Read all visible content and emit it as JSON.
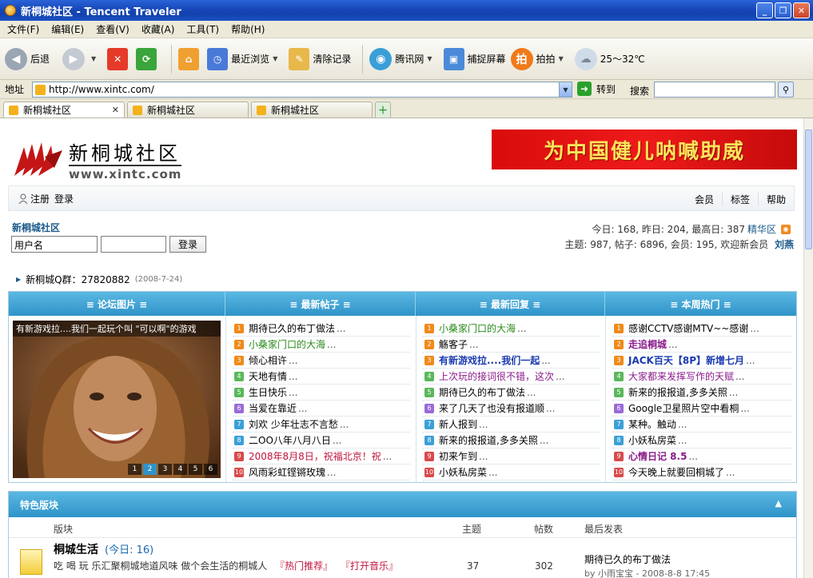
{
  "window": {
    "title": "新桐城社区 - Tencent Traveler"
  },
  "menu": [
    "文件(F)",
    "编辑(E)",
    "查看(V)",
    "收藏(A)",
    "工具(T)",
    "帮助(H)"
  ],
  "toolbar": {
    "back": "后退",
    "recent": "最近浏览",
    "clear": "清除记录",
    "tencent": "腾讯网",
    "capture": "捕捉屏幕",
    "paipai": "拍拍",
    "paipai_icon": "拍",
    "weather": "25～32℃"
  },
  "address": {
    "label": "地址",
    "url": "http://www.xintc.com/",
    "go": "转到",
    "search_label": "搜索"
  },
  "tabs": [
    "新桐城社区",
    "新桐城社区",
    "新桐城社区"
  ],
  "site": {
    "logo_name": "新桐城社区",
    "logo_url": "www.xintc.com",
    "banner": "为中国健儿呐喊助威"
  },
  "userbar": {
    "register": "注册",
    "login": "登录",
    "right": [
      "会员",
      "标签",
      "帮助"
    ]
  },
  "login": {
    "forum_name": "新桐城社区",
    "username_value": "用户名",
    "button": "登录"
  },
  "stats": {
    "line1": "今日: 168, 昨日: 204, 最高日: 387",
    "digest": "精华区",
    "line2": "主题: 987, 帖子: 6896, 会员: 195, 欢迎新会员",
    "new_member": "刘燕"
  },
  "qq": {
    "text": "新桐城Q群：27820882",
    "date": "(2008-7-24)"
  },
  "columns": [
    "≡ 论坛图片 ≡",
    "≡ 最新帖子 ≡",
    "≡ 最新回复 ≡",
    "≡ 本周热门 ≡"
  ],
  "picture": {
    "caption": "有新游戏拉....我们一起玩个叫 \"可以啊\"的游戏",
    "pages": [
      "1",
      "2",
      "3",
      "4",
      "5",
      "6"
    ]
  },
  "latest_posts": [
    {
      "n": "1",
      "t": "期待已久的布丁做法",
      "c": "#000000"
    },
    {
      "n": "2",
      "t": "小桑家门口的大海",
      "c": "#2a8a1a"
    },
    {
      "n": "3",
      "t": "倾心相许",
      "c": "#000000"
    },
    {
      "n": "4",
      "t": "天地有情",
      "c": "#000000"
    },
    {
      "n": "5",
      "t": "生日快乐",
      "c": "#000000"
    },
    {
      "n": "6",
      "t": "当爱在靠近",
      "c": "#000000"
    },
    {
      "n": "7",
      "t": "刘欢 少年壮志不言愁",
      "c": "#000000"
    },
    {
      "n": "8",
      "t": "二OO八年八月八日",
      "c": "#000000"
    },
    {
      "n": "9",
      "t": "2008年8月8日，祝福北京！祝",
      "c": "#c0143c"
    },
    {
      "n": "10",
      "t": "风雨彩虹铿锵玫瑰",
      "c": "#000000"
    }
  ],
  "latest_replies": [
    {
      "n": "1",
      "t": "小桑家门口的大海",
      "c": "#2a8a1a"
    },
    {
      "n": "2",
      "t": "觞客子",
      "c": "#000000"
    },
    {
      "n": "3",
      "t": "有新游戏拉....我们一起",
      "c": "#1a3ab0",
      "b": true
    },
    {
      "n": "4",
      "t": "上次玩的接词很不错，这次",
      "c": "#8a1a8a"
    },
    {
      "n": "5",
      "t": "期待已久的布丁做法",
      "c": "#000000"
    },
    {
      "n": "6",
      "t": "来了几天了也没有报道顺",
      "c": "#000000"
    },
    {
      "n": "7",
      "t": "新人报到",
      "c": "#000000"
    },
    {
      "n": "8",
      "t": "新来的报报道,多多关照",
      "c": "#000000"
    },
    {
      "n": "9",
      "t": "初来乍到",
      "c": "#000000"
    },
    {
      "n": "10",
      "t": "小妖私房菜",
      "c": "#000000"
    }
  ],
  "weekly_hot": [
    {
      "n": "1",
      "t": "感谢CCTV感谢MTV~~感谢",
      "c": "#000000"
    },
    {
      "n": "2",
      "t": "走追桐城",
      "c": "#8a1a8a",
      "b": true
    },
    {
      "n": "3",
      "t": "JACK百天【8P】新增七月",
      "c": "#1a3ab0",
      "b": true
    },
    {
      "n": "4",
      "t": "大家都来发挥写作的天赋",
      "c": "#8a1a8a"
    },
    {
      "n": "5",
      "t": "新来的报报道,多多关照",
      "c": "#000000"
    },
    {
      "n": "6",
      "t": "Google卫星照片空中看桐",
      "c": "#000000"
    },
    {
      "n": "7",
      "t": "某种。触动",
      "c": "#000000"
    },
    {
      "n": "8",
      "t": "小妖私房菜",
      "c": "#000000"
    },
    {
      "n": "9",
      "t": "心情日记 8.5",
      "c": "#8a1a8a",
      "b": true
    },
    {
      "n": "10",
      "t": "今天晚上就要回桐城了",
      "c": "#000000"
    }
  ],
  "special": {
    "title": "特色版块",
    "headers": {
      "board": "版块",
      "topics": "主题",
      "posts": "帖数",
      "last": "最后发表"
    },
    "boards": [
      {
        "name": "桐城生活",
        "today": "(今日: 16)",
        "desc": "吃 喝 玩 乐汇聚桐城地道风味 做个会生活的桐城人",
        "links": [
          "『热门推荐』",
          "『打开音乐』"
        ],
        "topics": "37",
        "posts": "302",
        "last_title": "期待已久的布丁做法",
        "last_by": "by 小雨宝宝 - 2008-8-8 17:45"
      }
    ]
  },
  "colors": {
    "accent": "#2f93c8",
    "link": "#1a5a8a",
    "banner_red": "#e01010"
  }
}
